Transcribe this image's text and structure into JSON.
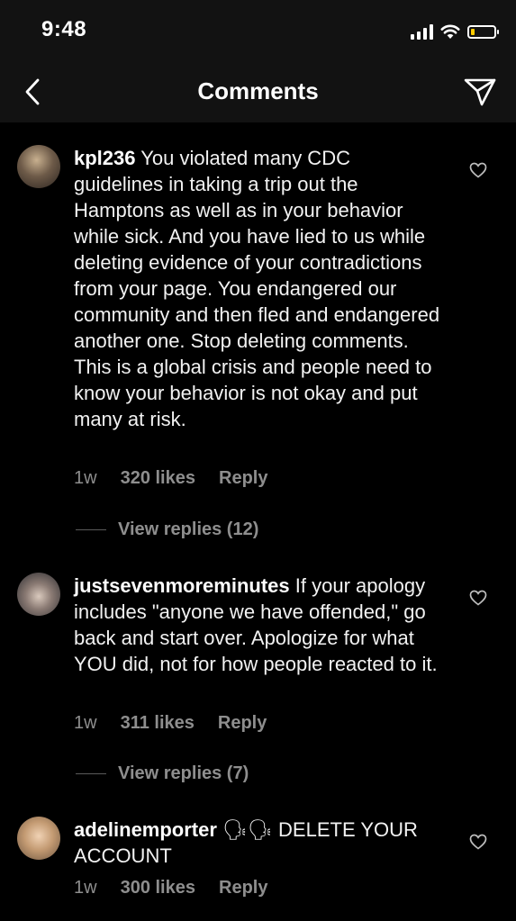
{
  "status_bar": {
    "time": "9:48",
    "battery_level": 0.15,
    "battery_color": "#ffcc00",
    "icons": [
      "signal-icon",
      "wifi-icon",
      "battery-icon"
    ]
  },
  "nav": {
    "title": "Comments",
    "back_icon": "chevron-left-icon",
    "share_icon": "direct-send-icon"
  },
  "comments": [
    {
      "username": "kpl236",
      "text": "You violated many CDC guidelines in taking a trip out the Hamptons as well as in your behavior while sick. And you have lied to us while deleting evidence of your contradictions from your page. You endangered our community and then fled and endangered another one. Stop deleting comments. This is a global crisis and people need to know your behavior is not okay and put many at risk.",
      "time": "1w",
      "likes": "320 likes",
      "reply_label": "Reply",
      "view_replies": "View replies (12)"
    },
    {
      "username": "justsevenmoreminutes",
      "text": "If your apology includes \"anyone we have offended,\" go back and start over. Apologize for what YOU did, not for how people reacted to it.",
      "time": "1w",
      "likes": "311 likes",
      "reply_label": "Reply",
      "view_replies": "View replies (7)"
    },
    {
      "username": "adelinemporter",
      "emoji": "🗣🗣",
      "text": "DELETE YOUR ACCOUNT",
      "time": "1w",
      "likes": "300 likes",
      "reply_label": "Reply"
    }
  ],
  "colors": {
    "background": "#000000",
    "header": "#121212",
    "secondary_text": "#8e8e8e"
  }
}
